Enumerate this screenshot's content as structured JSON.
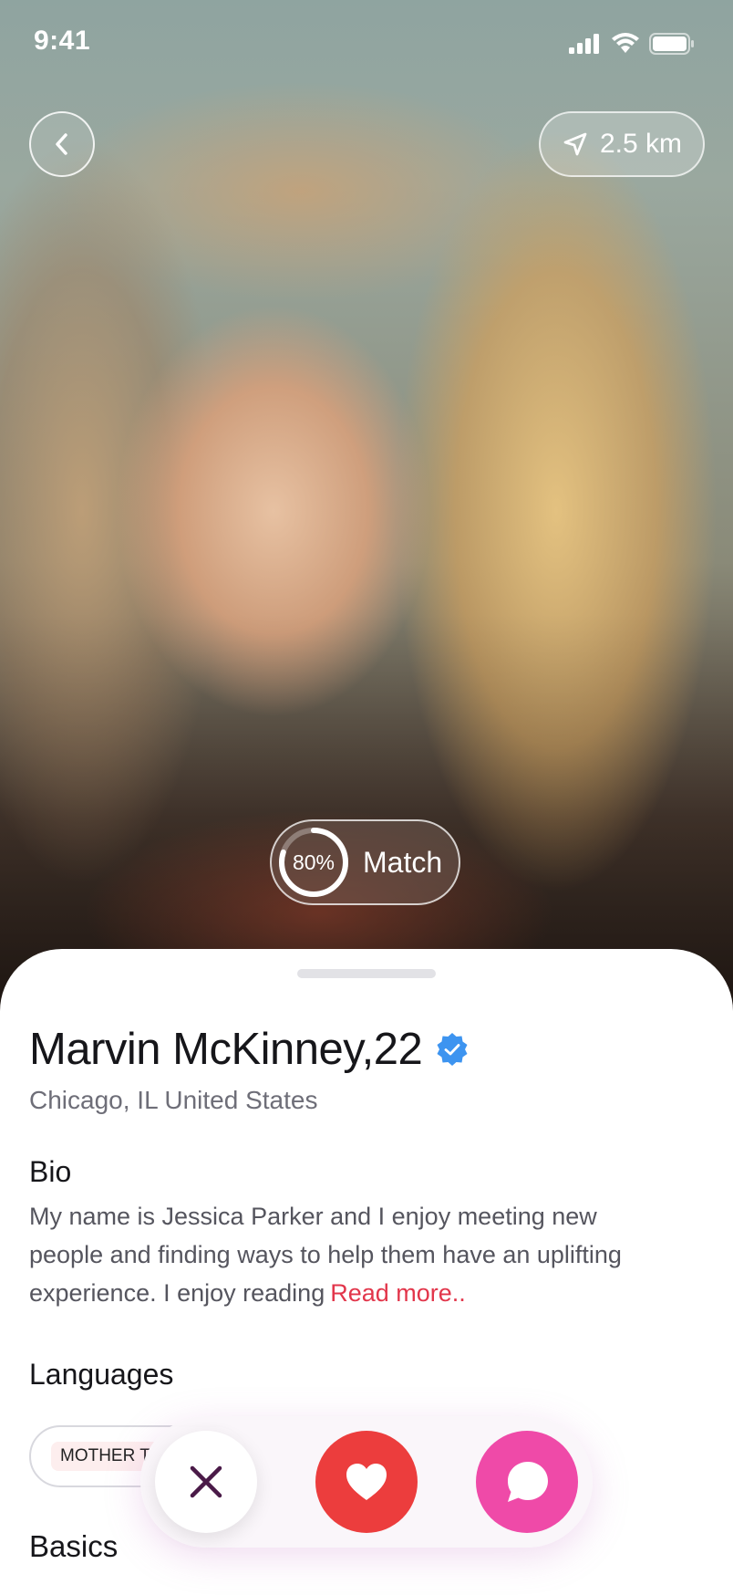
{
  "status_bar": {
    "time": "9:41"
  },
  "header": {
    "distance": "2.5 km"
  },
  "match": {
    "percent": 80,
    "percent_label": "80%",
    "label": "Match"
  },
  "profile": {
    "name": "Marvin McKinney,22",
    "verified": true,
    "location": "Chicago, IL United States",
    "bio_title": "Bio",
    "bio_text": "My name is Jessica Parker and I enjoy meeting new people and finding ways to help them have an uplifting experience. I enjoy reading",
    "read_more": "Read more..",
    "languages_title": "Languages",
    "languages": [
      "MOTHER T"
    ],
    "basics_title": "Basics"
  },
  "actions": {
    "dislike_icon": "close-icon",
    "like_icon": "heart-icon",
    "chat_icon": "chat-bubble-icon"
  },
  "colors": {
    "accent_red": "#ec3d3d",
    "accent_pink": "#ef4aa8",
    "read_more": "#e2364b",
    "verified_blue": "#3d94f0",
    "dislike_x": "#4a1a48"
  }
}
